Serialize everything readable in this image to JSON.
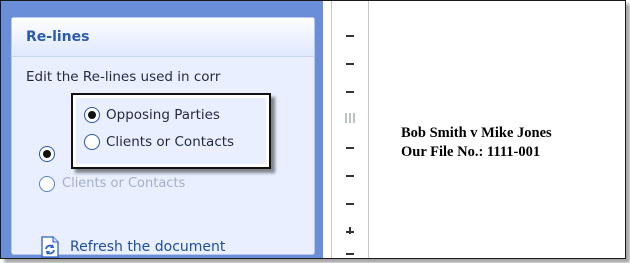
{
  "taskpane": {
    "title": "Re-lines",
    "description": "Edit the Re-lines used in corr",
    "ghost_option_text": "Clients or Contacts",
    "refresh_label": "Refresh the document"
  },
  "callout": {
    "options": [
      {
        "label": "Opposing Parties",
        "checked": true
      },
      {
        "label": "Clients or Contacts",
        "checked": false
      }
    ]
  },
  "document": {
    "line1": "Bob Smith v Mike Jones",
    "line2": "Our File No.: 1111-001"
  },
  "colors": {
    "taskpane_bg": "#6a8fd8",
    "panel_bg": "#e9efff",
    "title_color": "#2a5bb0",
    "link_color": "#1f4fa0"
  },
  "icons": [
    "refresh-document-icon",
    "ruler-grip-icon"
  ]
}
